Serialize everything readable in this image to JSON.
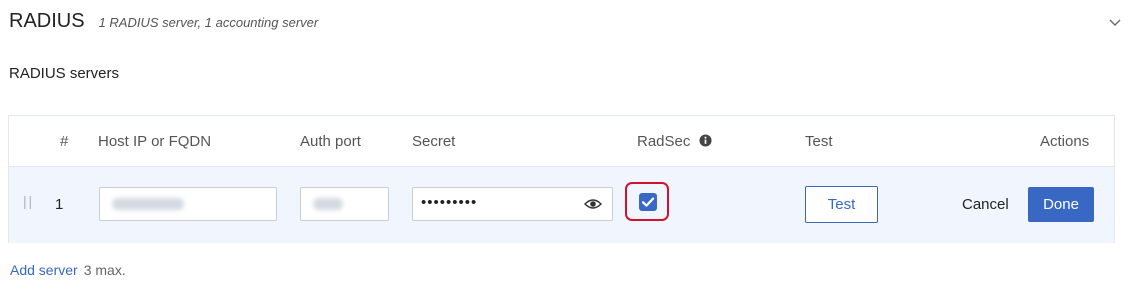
{
  "section": {
    "title": "RADIUS",
    "summary": "1 RADIUS server, 1 accounting server"
  },
  "servers": {
    "heading": "RADIUS servers",
    "columns": {
      "index": "#",
      "host": "Host IP or FQDN",
      "auth_port": "Auth port",
      "secret": "Secret",
      "radsec": "RadSec",
      "test": "Test",
      "actions": "Actions"
    },
    "rows": [
      {
        "index": "1",
        "secret_masked": "•••••••••",
        "radsec_checked": true,
        "test_label": "Test",
        "cancel_label": "Cancel",
        "done_label": "Done"
      }
    ]
  },
  "footer": {
    "add_label": "Add server",
    "max_note": "3 max."
  },
  "icons": {
    "collapse": "chevron-down-icon",
    "radsec_info": "info-icon",
    "reveal": "eye-icon",
    "drag": "drag-handle-icon"
  },
  "colors": {
    "accent": "#3868c4",
    "highlight": "#d0122e",
    "row_bg": "#f1f6fe"
  }
}
